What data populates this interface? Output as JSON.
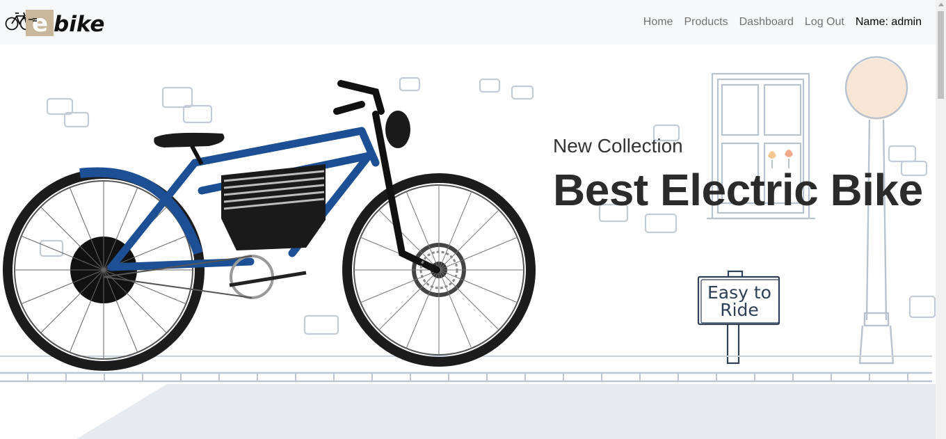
{
  "brand": {
    "logo_text": "bike",
    "logo_letter": "e"
  },
  "nav": {
    "items": [
      {
        "label": "Home"
      },
      {
        "label": "Products"
      },
      {
        "label": "Dashboard"
      },
      {
        "label": "Log Out"
      }
    ],
    "user_label": "Name: admin"
  },
  "hero": {
    "subtitle": "New Collection",
    "title": "Best Electric Bike",
    "sign_text_line1": "Easy to",
    "sign_text_line2": "Ride"
  },
  "colors": {
    "navbar_bg": "#f8f9fa",
    "bike_frame": "#1d4f95",
    "sketch_line": "#b9c3cf",
    "ground": "#e7eaee",
    "lamp_glow": "#f7e6d6"
  }
}
